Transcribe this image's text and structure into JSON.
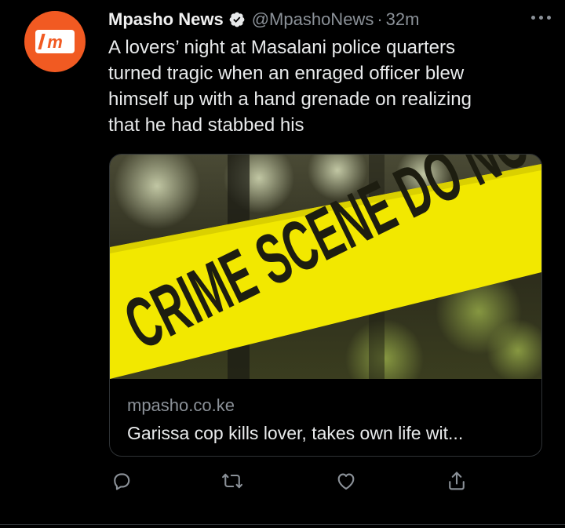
{
  "tweet": {
    "display_name": "Mpasho News",
    "handle": "@MpashoNews",
    "separator": "·",
    "time": "32m",
    "avatar_icon": "mpasho-logo",
    "verified_icon": "verified-badge-icon",
    "text_lines": [
      "A lovers’ night at Masalani police quarters",
      "turned tragic when an enraged officer blew",
      "himself up with a hand grenade on realizing",
      "that he had stabbed his"
    ]
  },
  "card": {
    "image_tape_text": "CRIME SCENE DO NOT CROSS",
    "domain": "mpasho.co.ke",
    "title": "Garissa cop kills lover, takes own life wit..."
  },
  "actions": {
    "icons": [
      "reply-icon",
      "retweet-icon",
      "like-icon",
      "share-icon"
    ]
  },
  "colors": {
    "background": "#000000",
    "brand_orange": "#f15a22",
    "tape_yellow": "#f2e800",
    "muted_text": "#8b9198",
    "primary_text": "#e9ebec"
  }
}
